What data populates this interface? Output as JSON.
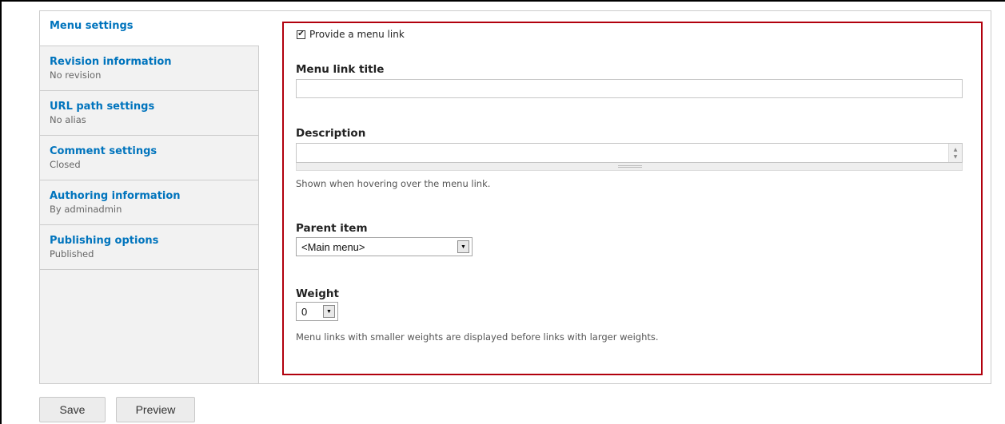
{
  "vertical_tabs": [
    {
      "title": "Menu settings",
      "summary": ""
    },
    {
      "title": "Revision information",
      "summary": "No revision"
    },
    {
      "title": "URL path settings",
      "summary": "No alias"
    },
    {
      "title": "Comment settings",
      "summary": "Closed"
    },
    {
      "title": "Authoring information",
      "summary": "By adminadmin"
    },
    {
      "title": "Publishing options",
      "summary": "Published"
    }
  ],
  "menu_settings": {
    "provide_link_label": "Provide a menu link",
    "provide_link_checked": true,
    "link_title_label": "Menu link title",
    "link_title_value": "",
    "description_label": "Description",
    "description_value": "",
    "description_help": "Shown when hovering over the menu link.",
    "parent_label": "Parent item",
    "parent_value": "<Main menu>",
    "weight_label": "Weight",
    "weight_value": "0",
    "weight_help": "Menu links with smaller weights are displayed before links with larger weights."
  },
  "actions": {
    "save_label": "Save",
    "preview_label": "Preview"
  },
  "colors": {
    "tab_link": "#0074bd",
    "highlight_border": "#b1000d"
  },
  "icons": {
    "checkbox_mark": "✔",
    "dropdown_arrow": "▼"
  }
}
